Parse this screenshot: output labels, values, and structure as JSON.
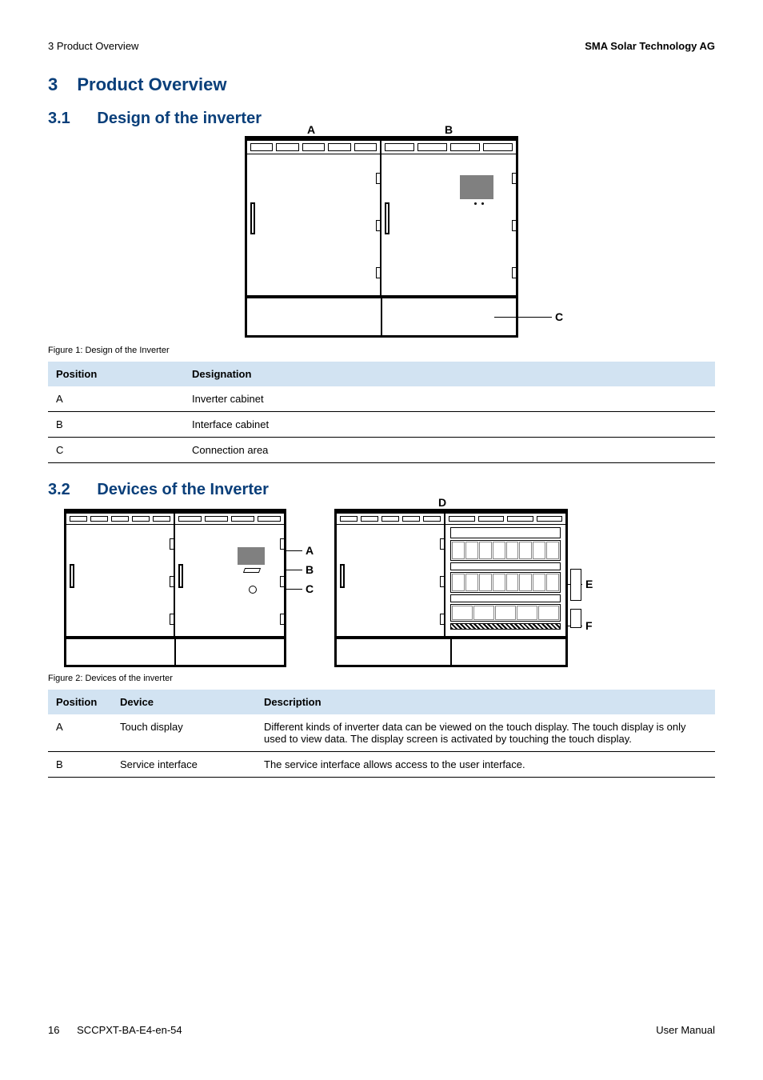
{
  "header": {
    "left": "3 Product Overview",
    "right": "SMA Solar Technology AG"
  },
  "section": {
    "num": "3",
    "title": "Product Overview"
  },
  "sub1": {
    "num": "3.1",
    "title": "Design of the inverter"
  },
  "fig1": {
    "caption": "Figure 1: Design of the Inverter",
    "labels": {
      "A": "A",
      "B": "B",
      "C": "C"
    }
  },
  "table1": {
    "headers": {
      "position": "Position",
      "designation": "Designation"
    },
    "rows": [
      {
        "pos": "A",
        "des": "Inverter cabinet"
      },
      {
        "pos": "B",
        "des": "Interface cabinet"
      },
      {
        "pos": "C",
        "des": "Connection area"
      }
    ]
  },
  "sub2": {
    "num": "3.2",
    "title": "Devices of the Inverter"
  },
  "fig2": {
    "caption": "Figure 2: Devices of the inverter",
    "labels": {
      "A": "A",
      "B": "B",
      "C": "C",
      "D": "D",
      "E": "E",
      "F": "F"
    }
  },
  "table2": {
    "headers": {
      "position": "Position",
      "device": "Device",
      "description": "Description"
    },
    "rows": [
      {
        "pos": "A",
        "dev": "Touch display",
        "desc": "Different kinds of inverter data can be viewed on the touch display. The touch display is only used to view data. The display screen is activated by touching the touch display."
      },
      {
        "pos": "B",
        "dev": "Service interface",
        "desc": "The service interface allows access to the user interface."
      }
    ]
  },
  "footer": {
    "page": "16",
    "doc": "SCCPXT-BA-E4-en-54",
    "right": "User Manual"
  }
}
